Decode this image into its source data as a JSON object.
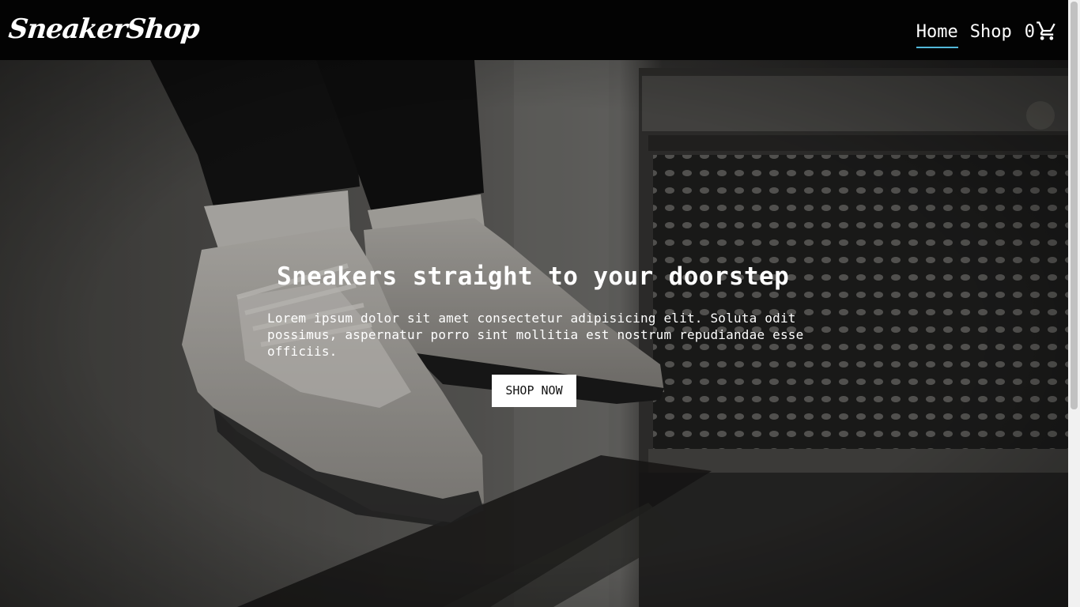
{
  "header": {
    "brand": "SneakerShop",
    "nav": [
      {
        "label": "Home",
        "active": true
      },
      {
        "label": "Shop",
        "active": false
      }
    ],
    "cart": {
      "count": "0",
      "icon": "shopping-cart-icon"
    }
  },
  "hero": {
    "title": "Sneakers straight to your doorstep",
    "text": "Lorem ipsum dolor sit amet consectetur adipisicing elit. Soluta odit possimus, aspernatur porro sint mollitia est nostrum repudiandae esse officiis.",
    "button_label": "SHOP NOW",
    "background_image": "sneakers-hanging-feet-photo"
  },
  "colors": {
    "nav_background": "#030303",
    "active_underline": "#52b8d9",
    "text": "#ffffff",
    "button_background": "#ffffff",
    "button_text": "#111111"
  }
}
